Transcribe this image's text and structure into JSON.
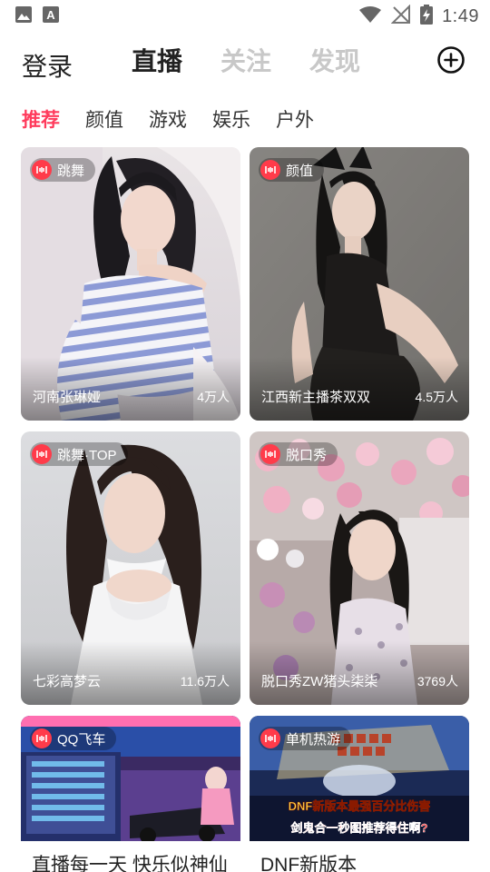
{
  "status_bar": {
    "time": "1:49",
    "left_icons": [
      "image-icon",
      "font-a-icon"
    ],
    "right_icons": [
      "wifi-icon",
      "no-signal-icon",
      "battery-charging-icon"
    ]
  },
  "header": {
    "login_label": "登录",
    "tabs": [
      {
        "label": "直播",
        "active": true
      },
      {
        "label": "关注",
        "active": false
      },
      {
        "label": "发现",
        "active": false
      }
    ],
    "add_icon": "plus-circle-icon"
  },
  "categories": [
    {
      "label": "推荐",
      "active": true
    },
    {
      "label": "颜值",
      "active": false
    },
    {
      "label": "游戏",
      "active": false
    },
    {
      "label": "娱乐",
      "active": false
    },
    {
      "label": "户外",
      "active": false
    }
  ],
  "cards": [
    {
      "tag": "跳舞",
      "title": "河南张琳娅",
      "viewers": "4万人"
    },
    {
      "tag": "颜值",
      "title": "江西新主播茶双双",
      "viewers": "4.5万人"
    },
    {
      "tag": "跳舞·TOP",
      "title": "七彩高梦云",
      "viewers": "11.6万人"
    },
    {
      "tag": "脱口秀",
      "title": "脱口秀ZW猪头柒柒",
      "viewers": "3769人"
    },
    {
      "tag": "QQ飞车",
      "title": "直播每一天 快乐似神仙",
      "viewers": ""
    },
    {
      "tag": "单机热游",
      "title": "DNF新版本",
      "viewers": ""
    }
  ],
  "game_banner": {
    "line1": "DNF新版本最强百分比伤害",
    "line2": "剑鬼合一秒图推荐得住啊?"
  },
  "colors": {
    "accent": "#ff3b5c",
    "live_badge": "#ff3b4a",
    "inactive_tab": "#c8c8c8"
  }
}
